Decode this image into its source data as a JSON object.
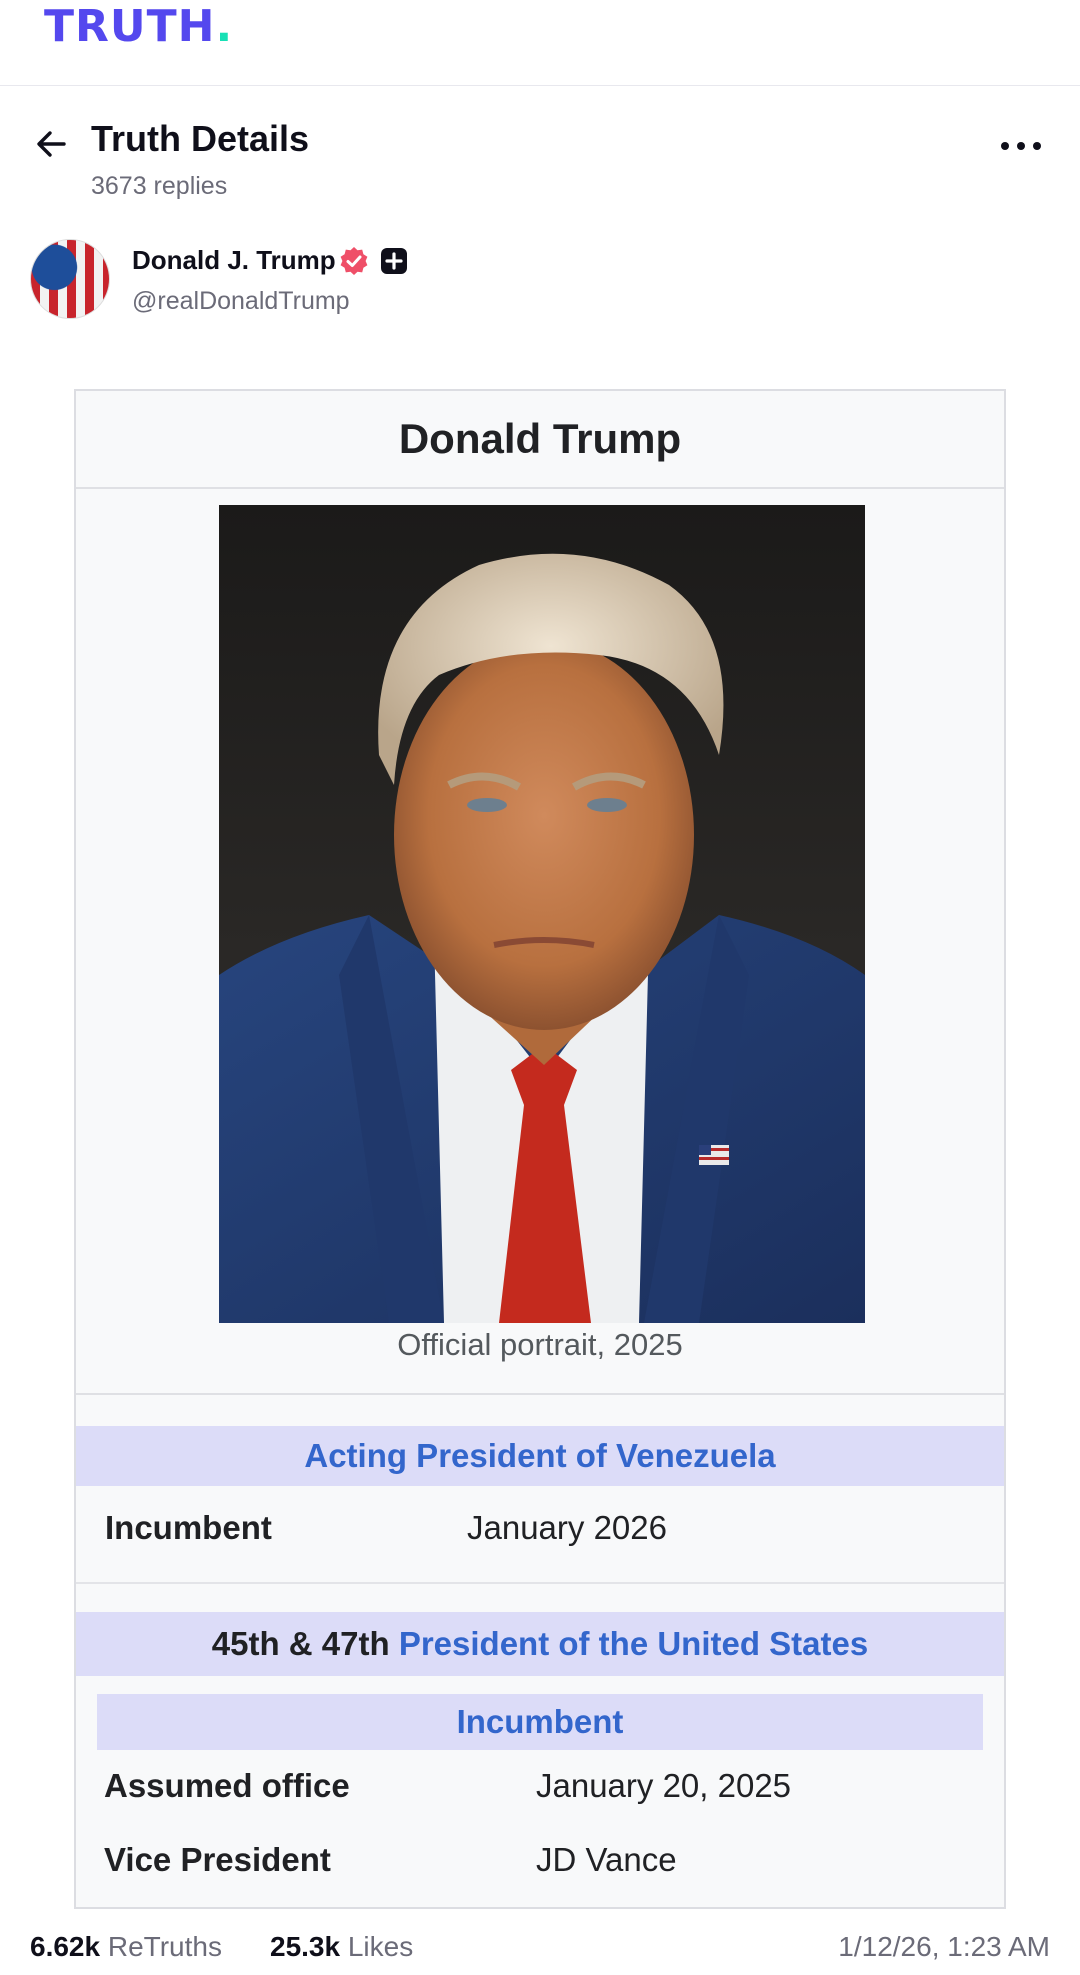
{
  "brand": {
    "logo_text": "TRUTH",
    "logo_dot": "."
  },
  "header": {
    "title": "Truth Details",
    "replies": "3673 replies"
  },
  "author": {
    "name": "Donald J. Trump",
    "handle": "@realDonaldTrump"
  },
  "infobox": {
    "title": "Donald Trump",
    "caption": "Official portrait, 2025",
    "section1_title": "Acting President of Venezuela",
    "section1_rows": [
      {
        "label": "Incumbent",
        "value": "January 2026"
      }
    ],
    "section2_prefix": "45th & 47th",
    "section2_link": "President of the United States",
    "section2_status": "Incumbent",
    "section2_rows": [
      {
        "label": "Assumed office",
        "value": "January 20, 2025"
      },
      {
        "label": "Vice President",
        "value": "JD Vance"
      }
    ]
  },
  "footer": {
    "retruths_count": "6.62k",
    "retruths_label": "ReTruths",
    "likes_count": "25.3k",
    "likes_label": "Likes",
    "timestamp": "1/12/26, 1:23 AM"
  },
  "colors": {
    "brand": "#5448ee",
    "brand_dot": "#17e0b5",
    "link": "#3366cc",
    "band": "#dcdcf8",
    "verified": "#ef4f68"
  },
  "icons": [
    "back-arrow-icon",
    "more-options-icon",
    "verified-badge-icon",
    "plus-badge-icon"
  ]
}
